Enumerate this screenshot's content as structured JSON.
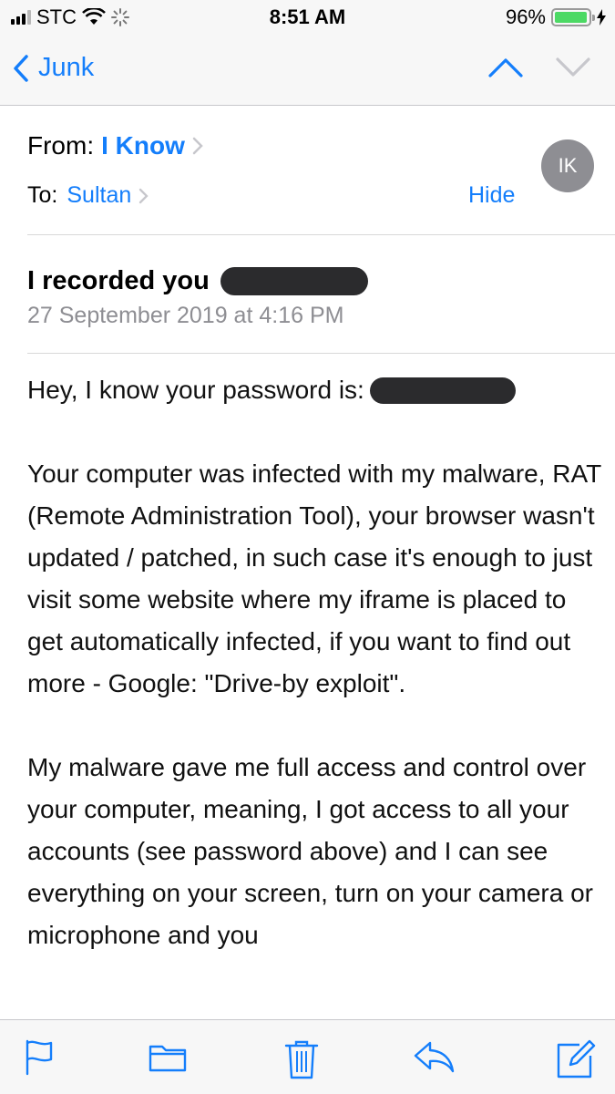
{
  "status_bar": {
    "carrier": "STC",
    "time": "8:51 AM",
    "battery_percent": "96%",
    "battery_level": 0.96
  },
  "nav": {
    "back_label": "Junk"
  },
  "header": {
    "from_label": "From:",
    "sender": "I Know",
    "to_label": "To:",
    "recipient": "Sultan",
    "hide_label": "Hide",
    "avatar_initials": "IK"
  },
  "message": {
    "subject": "I recorded you",
    "date": "27 September 2019 at 4:16 PM",
    "paragraphs": [
      "Hey, I know your password is:",
      "Your computer was infected with my malware, RAT (Remote Administration Tool), your browser wasn't updated / patched, in such case it's enough to just visit some website where my iframe is placed to get automatically infected, if you want to find out more - Google: \"Drive-by exploit\".",
      "My malware gave me full access and control over your computer, meaning, I got access to all your accounts (see password above) and I can see everything on your screen, turn on your camera or microphone and you"
    ]
  },
  "colors": {
    "accent": "#147efb",
    "battery_green": "#4cd964",
    "avatar_bg": "#8e8e93",
    "redaction": "#2b2b2d"
  },
  "toolbar": {
    "icons": [
      "flag-icon",
      "folder-icon",
      "trash-icon",
      "reply-icon",
      "compose-icon"
    ]
  }
}
